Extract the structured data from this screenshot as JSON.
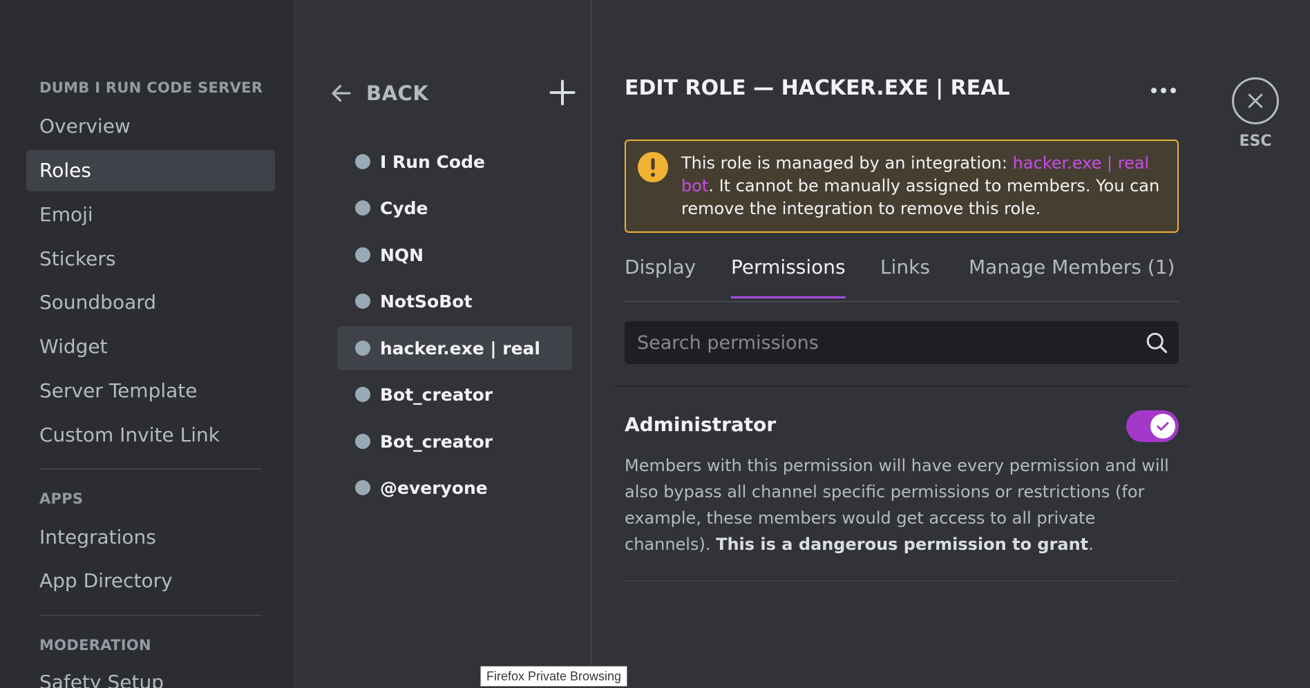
{
  "sidebar": {
    "server_header": "DUMB I RUN CODE SERVER ...",
    "items": [
      {
        "label": "Overview"
      },
      {
        "label": "Roles"
      },
      {
        "label": "Emoji"
      },
      {
        "label": "Stickers"
      },
      {
        "label": "Soundboard"
      },
      {
        "label": "Widget"
      },
      {
        "label": "Server Template"
      },
      {
        "label": "Custom Invite Link"
      }
    ],
    "apps_header": "APPS",
    "apps_items": [
      {
        "label": "Integrations"
      },
      {
        "label": "App Directory"
      }
    ],
    "moderation_header": "MODERATION",
    "moderation_items": [
      {
        "label": "Safety Setup"
      }
    ],
    "active_item": "Roles"
  },
  "roles_list": {
    "back_label": "BACK",
    "roles": [
      {
        "name": "I Run Code"
      },
      {
        "name": "Cyde"
      },
      {
        "name": "NQN"
      },
      {
        "name": "NotSoBot"
      },
      {
        "name": "hacker.exe | real"
      },
      {
        "name": "Bot_creator"
      },
      {
        "name": "Bot_creator"
      },
      {
        "name": "@everyone"
      }
    ],
    "selected_role": "hacker.exe | real",
    "role_dot_color": "#99aab5"
  },
  "editor": {
    "title": "EDIT ROLE — HACKER.EXE | REAL",
    "notice": {
      "prefix": "This role is managed by an integration: ",
      "link": "hacker.exe | real bot",
      "suffix": ". It cannot be manually assigned to members. You can remove the integration to remove this role."
    },
    "tabs": [
      {
        "label": "Display"
      },
      {
        "label": "Permissions"
      },
      {
        "label": "Links"
      },
      {
        "label": "Manage Members (1)"
      }
    ],
    "active_tab": "Permissions",
    "search_placeholder": "Search permissions",
    "permission": {
      "title": "Administrator",
      "enabled": true,
      "description": "Members with this permission will have every permission and will also bypass all channel specific permissions or restrictions (for example, these members would get access to all private channels). ",
      "description_bold": "This is a dangerous permission to grant",
      "description_end": "."
    }
  },
  "close": {
    "esc_label": "ESC"
  },
  "browser_tooltip": "Firefox Private Browsing",
  "colors": {
    "accent": "#a338c9",
    "tab_underline": "#a64ce0",
    "warning": "#f0b232",
    "link": "#c94bea"
  },
  "icons": [
    "arrow-left-icon",
    "plus-icon",
    "more-horizontal-icon",
    "warning-icon",
    "search-icon",
    "check-icon",
    "close-icon"
  ]
}
